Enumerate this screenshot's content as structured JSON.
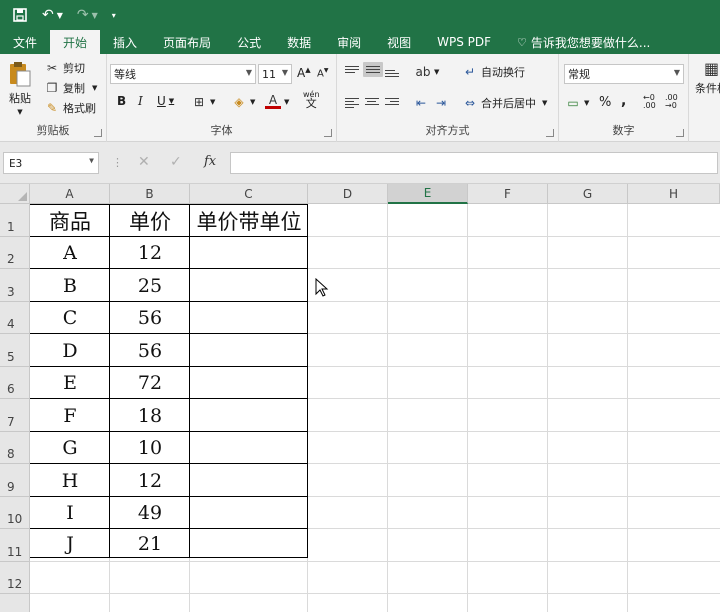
{
  "quick_access": {
    "save_icon": "save-icon",
    "undo_icon": "undo-icon",
    "redo_icon": "redo-icon",
    "customize_icon": "customize-icon"
  },
  "tabs": [
    {
      "label": "文件",
      "active": false
    },
    {
      "label": "开始",
      "active": true
    },
    {
      "label": "插入",
      "active": false
    },
    {
      "label": "页面布局",
      "active": false
    },
    {
      "label": "公式",
      "active": false
    },
    {
      "label": "数据",
      "active": false
    },
    {
      "label": "审阅",
      "active": false
    },
    {
      "label": "视图",
      "active": false
    },
    {
      "label": "WPS PDF",
      "active": false
    },
    {
      "label": "告诉我您想要做什么...",
      "active": false
    }
  ],
  "ribbon": {
    "clipboard": {
      "paste": "粘贴",
      "cut": "剪切",
      "copy": "复制",
      "format_painter": "格式刷",
      "group_label": "剪贴板"
    },
    "font": {
      "font_name": "等线",
      "font_size": "11",
      "bold": "B",
      "italic": "I",
      "underline": "U",
      "wen": "wén",
      "wen_char": "文",
      "group_label": "字体"
    },
    "alignment": {
      "wrap_text": "自动换行",
      "merge_center": "合并后居中",
      "group_label": "对齐方式"
    },
    "number": {
      "format": "常规",
      "percent": "%",
      "comma": ",",
      "group_label": "数字"
    },
    "styles": {
      "conditional": "条件格"
    }
  },
  "formula_bar": {
    "name_box": "E3",
    "formula": ""
  },
  "columns": [
    "A",
    "B",
    "C",
    "D",
    "E",
    "F",
    "G",
    "H"
  ],
  "rows": [
    "1",
    "2",
    "3",
    "4",
    "5",
    "6",
    "7",
    "8",
    "9",
    "10",
    "11",
    "12"
  ],
  "table": {
    "headers": [
      "商品",
      "单价",
      "单价带单位"
    ],
    "rows": [
      [
        "A",
        "12",
        ""
      ],
      [
        "B",
        "25",
        ""
      ],
      [
        "C",
        "56",
        ""
      ],
      [
        "D",
        "56",
        ""
      ],
      [
        "E",
        "72",
        ""
      ],
      [
        "F",
        "18",
        ""
      ],
      [
        "G",
        "10",
        ""
      ],
      [
        "H",
        "12",
        ""
      ],
      [
        "I",
        "49",
        ""
      ],
      [
        "J",
        "21",
        ""
      ]
    ]
  },
  "selected_cell": "E3",
  "colors": {
    "accent": "#217346",
    "ribbon_bg": "#f3f3f3",
    "header_bg": "#e6e6e6"
  }
}
